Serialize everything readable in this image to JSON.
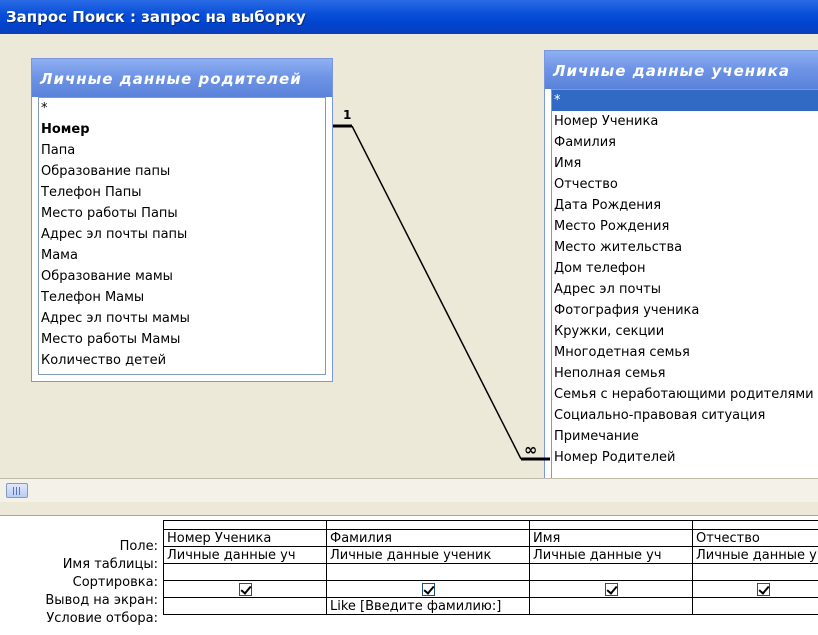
{
  "window": {
    "title": "Запрос Поиск : запрос на выборку"
  },
  "parents_table": {
    "title": "Личные данные родителей",
    "fields": [
      {
        "label": "*"
      },
      {
        "label": "Номер"
      },
      {
        "label": "Папа"
      },
      {
        "label": "Образование папы"
      },
      {
        "label": "Телефон Папы"
      },
      {
        "label": "Место работы Папы"
      },
      {
        "label": "Адрес эл почты папы"
      },
      {
        "label": "Мама"
      },
      {
        "label": "Образование мамы"
      },
      {
        "label": "Телефон Мамы"
      },
      {
        "label": "Адрес эл почты мамы"
      },
      {
        "label": "Место работы Мамы"
      },
      {
        "label": "Количество детей"
      }
    ]
  },
  "student_table": {
    "title": "Личные данные ученика",
    "fields": [
      {
        "label": "*"
      },
      {
        "label": "Номер Ученика"
      },
      {
        "label": "Фамилия"
      },
      {
        "label": "Имя"
      },
      {
        "label": "Отчество"
      },
      {
        "label": "Дата Рождения"
      },
      {
        "label": "Место Рождения"
      },
      {
        "label": "Место жительства"
      },
      {
        "label": "Дом телефон"
      },
      {
        "label": "Адрес эл почты"
      },
      {
        "label": "Фотография ученика"
      },
      {
        "label": "Кружки, секции"
      },
      {
        "label": "Многодетная семья"
      },
      {
        "label": "Неполная семья"
      },
      {
        "label": "Семья с неработающими родителями"
      },
      {
        "label": "Социально-правовая ситуация"
      },
      {
        "label": "Примечание"
      },
      {
        "label": "Номер Родителей"
      }
    ]
  },
  "relationship": {
    "one_label": "1",
    "many_label": "∞"
  },
  "grid": {
    "row_labels": {
      "field": "Поле:",
      "table": "Имя таблицы:",
      "sort": "Сортировка:",
      "show": "Вывод на экран:",
      "criteria": "Условие отбора:"
    },
    "columns": [
      {
        "field": "Номер Ученика",
        "table": "Личные данные уч",
        "sort": "",
        "show": true,
        "criteria": ""
      },
      {
        "field": "Фамилия",
        "table": "Личные данные ученик",
        "sort": "",
        "show": true,
        "criteria": "Like [Введите фамилию:]"
      },
      {
        "field": "Имя",
        "table": "Личные данные уч",
        "sort": "",
        "show": true,
        "criteria": ""
      },
      {
        "field": "Отчество",
        "table": "Личные данные у",
        "sort": "",
        "show": true,
        "criteria": ""
      }
    ]
  }
}
